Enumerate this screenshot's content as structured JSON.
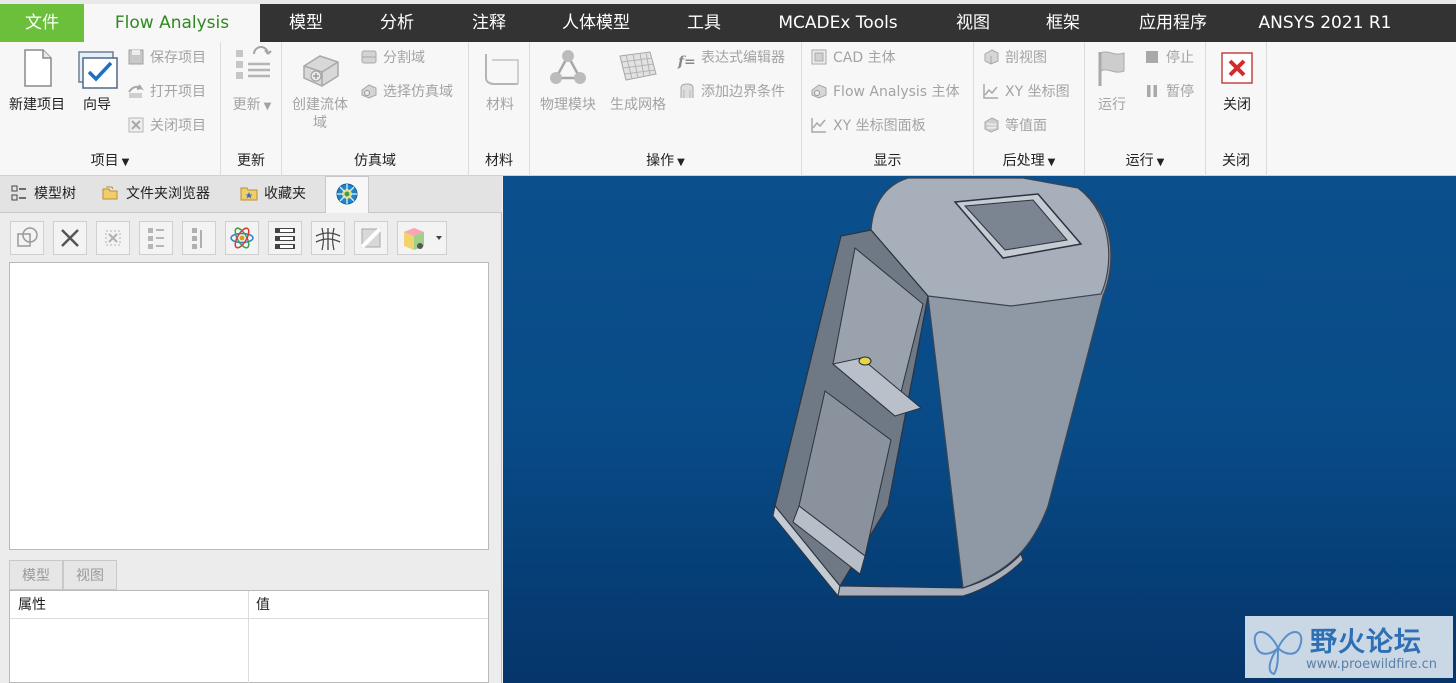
{
  "tabs": {
    "file": "文件",
    "flow_analysis": "Flow Analysis",
    "model": "模型",
    "analysis": "分析",
    "annotate": "注释",
    "manikin": "人体模型",
    "tools": "工具",
    "mcadex": "MCADEx Tools",
    "view": "视图",
    "framework": "框架",
    "apps": "应用程序",
    "ansys": "ANSYS 2021 R1"
  },
  "ribbon": {
    "project": {
      "label": "项目",
      "new_project": "新建项目",
      "wizard": "向导",
      "save_project": "保存项目",
      "open_project": "打开项目",
      "close_project": "关闭项目"
    },
    "update": {
      "label": "更新",
      "update_btn": "更新"
    },
    "domain": {
      "label": "仿真域",
      "create_fluid_line1": "创建流体",
      "create_fluid_line2": "域",
      "split_domain": "分割域",
      "select_domain": "选择仿真域"
    },
    "material": {
      "label": "材料",
      "material_btn": "材料"
    },
    "operations": {
      "label": "操作",
      "physics": "物理模块",
      "mesh": "生成网格",
      "expr_editor": "表达式编辑器",
      "add_bc": "添加边界条件"
    },
    "display": {
      "label": "显示",
      "cad_body": "CAD 主体",
      "fa_body": "Flow Analysis 主体",
      "xy_panel": "XY 坐标图面板"
    },
    "post": {
      "label": "后处理",
      "section_view": "剖视图",
      "xy_plot": "XY 坐标图",
      "contour": "等值面"
    },
    "run": {
      "label": "运行",
      "run_btn": "运行",
      "stop": "停止",
      "pause": "暂停"
    },
    "close": {
      "label": "关闭",
      "close_btn": "关闭"
    }
  },
  "left_panel": {
    "nav_tabs": {
      "model_tree": "模型树",
      "folder_browser": "文件夹浏览器",
      "favorites": "收藏夹"
    },
    "sub_tabs": {
      "model": "模型",
      "view": "视图"
    },
    "prop_table": {
      "col_property": "属性",
      "col_value": "值"
    }
  },
  "watermark": {
    "title": "野火论坛",
    "url": "www.proewildfire.cn"
  },
  "colors": {
    "file_tab": "#6bbf3b",
    "tab_bar": "#333333",
    "active_tab_text": "#2e8a1f",
    "viewport_top": "#0b4f8c",
    "viewport_bottom": "#05356a",
    "model_gray": "#a3acb9",
    "close_red": "#d42a2a"
  }
}
